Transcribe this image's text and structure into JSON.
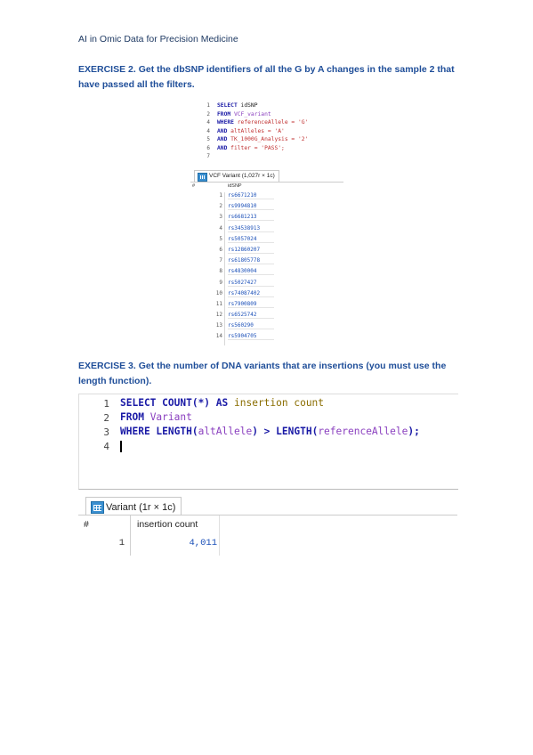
{
  "header": "AI in Omic Data for Precision Medicine",
  "exercise2": {
    "title": "EXERCISE 2. Get the dbSNP identifiers of all the G by A changes in the sample 2 that have passed all the filters.",
    "editor": {
      "line_numbers": [
        "1",
        "2",
        "4",
        "4",
        "5",
        "6",
        "7"
      ],
      "lines": [
        {
          "kw": "SELECT",
          "rest": " idSNP",
          "rest_class": "fn"
        },
        {
          "kw": "FROM",
          "rest": " VCF_variant",
          "rest_class": "tb"
        },
        {
          "kw": "WHERE",
          "rest": " referenceAllele = 'G'",
          "rest_class": "str"
        },
        {
          "kw": "AND",
          "rest": " altAlleles = 'A'",
          "rest_class": "str"
        },
        {
          "kw": "AND",
          "rest": " TK_1000G_Analysis = '2'",
          "rest_class": "str"
        },
        {
          "kw": "AND",
          "rest": " filter = 'PASS';",
          "rest_class": "str"
        },
        {
          "kw": "",
          "rest": "",
          "rest_class": "fn"
        }
      ]
    },
    "result_tab": "VCF Variant (1,027r × 1c)",
    "columns": [
      "#",
      "idSNP"
    ],
    "rows": [
      {
        "n": "1",
        "v": "rs6671210"
      },
      {
        "n": "2",
        "v": "rs9994810"
      },
      {
        "n": "3",
        "v": "rs6681213"
      },
      {
        "n": "4",
        "v": "rs34538913"
      },
      {
        "n": "5",
        "v": "rs5057024"
      },
      {
        "n": "6",
        "v": "rs12860207"
      },
      {
        "n": "7",
        "v": "rs61805778"
      },
      {
        "n": "8",
        "v": "rs4830004"
      },
      {
        "n": "9",
        "v": "rs5027427"
      },
      {
        "n": "10",
        "v": "rs74087402"
      },
      {
        "n": "11",
        "v": "rs7900809"
      },
      {
        "n": "12",
        "v": "rs6525742"
      },
      {
        "n": "13",
        "v": "rs560290"
      },
      {
        "n": "14",
        "v": "rs5904705"
      }
    ]
  },
  "exercise3": {
    "title": "EXERCISE 3. Get the number of DNA variants that are insertions (you must use the length function).",
    "editor": {
      "line_numbers": [
        "1",
        "2",
        "3",
        "4"
      ],
      "line1": {
        "kw1": "SELECT",
        "fn": " COUNT(*) ",
        "kw2": "AS",
        "alias": " insertion count"
      },
      "line2": {
        "kw": "FROM",
        "table": " Variant"
      },
      "line3": {
        "kw": "WHERE",
        "fn1": " LENGTH(",
        "col1": "altAllele",
        "mid": ") > ",
        "fn2": "LENGTH(",
        "col2": "referenceAllele",
        "end": ");"
      }
    },
    "result_tab": "Variant (1r × 1c)",
    "columns": [
      "#",
      "insertion count"
    ],
    "row": {
      "n": "1",
      "v": "4,011"
    }
  }
}
